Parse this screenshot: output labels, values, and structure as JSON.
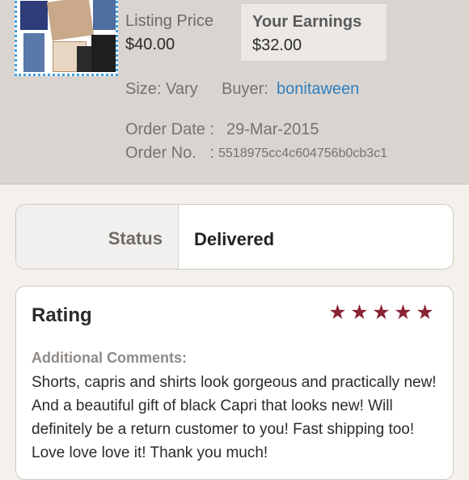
{
  "listing": {
    "price_label": "Listing Price",
    "price_value": "$40.00",
    "earnings_label": "Your Earnings",
    "earnings_value": "$32.00",
    "size_label": "Size: Vary",
    "buyer_label": "Buyer:",
    "buyer_name": "bonitaween",
    "order_date_label": "Order Date : ",
    "order_date_value": "29-Mar-2015",
    "order_no_label": "Order No.   : ",
    "order_no_value": "5518975cc4c604756b0cb3c1"
  },
  "status": {
    "label": "Status",
    "value": "Delivered"
  },
  "rating": {
    "title": "Rating",
    "stars": 5,
    "star_color": "#8a2233",
    "comments_label": "Additional Comments:",
    "comments_text": "Shorts, capris and shirts look gorgeous and practically new! And a beautiful gift of black Capri that looks new! Will definitely be a return customer to you! Fast shipping too! Love love love it! Thank you much!"
  },
  "colors": {
    "header_bg": "#d9d4cf",
    "link": "#2f7fbf"
  }
}
